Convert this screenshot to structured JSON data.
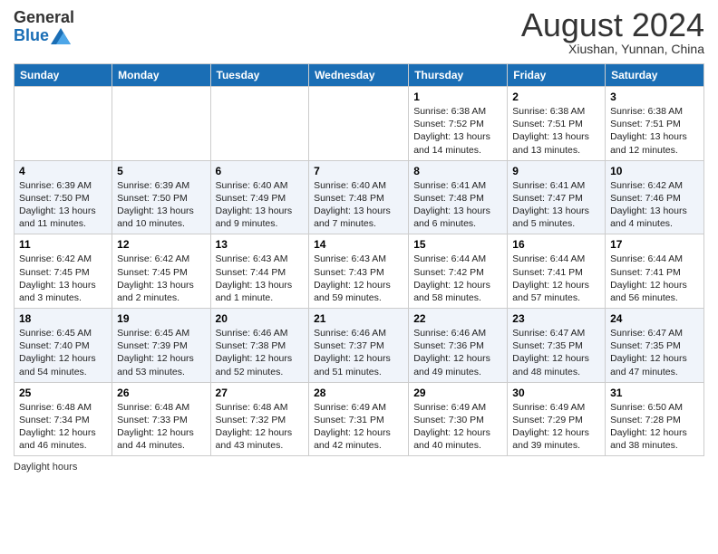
{
  "logo": {
    "general": "General",
    "blue": "Blue"
  },
  "title": "August 2024",
  "subtitle": "Xiushan, Yunnan, China",
  "days_header": [
    "Sunday",
    "Monday",
    "Tuesday",
    "Wednesday",
    "Thursday",
    "Friday",
    "Saturday"
  ],
  "weeks": [
    [
      {
        "day": "",
        "info": ""
      },
      {
        "day": "",
        "info": ""
      },
      {
        "day": "",
        "info": ""
      },
      {
        "day": "",
        "info": ""
      },
      {
        "day": "1",
        "info": "Sunrise: 6:38 AM\nSunset: 7:52 PM\nDaylight: 13 hours and 14 minutes."
      },
      {
        "day": "2",
        "info": "Sunrise: 6:38 AM\nSunset: 7:51 PM\nDaylight: 13 hours and 13 minutes."
      },
      {
        "day": "3",
        "info": "Sunrise: 6:38 AM\nSunset: 7:51 PM\nDaylight: 13 hours and 12 minutes."
      }
    ],
    [
      {
        "day": "4",
        "info": "Sunrise: 6:39 AM\nSunset: 7:50 PM\nDaylight: 13 hours and 11 minutes."
      },
      {
        "day": "5",
        "info": "Sunrise: 6:39 AM\nSunset: 7:50 PM\nDaylight: 13 hours and 10 minutes."
      },
      {
        "day": "6",
        "info": "Sunrise: 6:40 AM\nSunset: 7:49 PM\nDaylight: 13 hours and 9 minutes."
      },
      {
        "day": "7",
        "info": "Sunrise: 6:40 AM\nSunset: 7:48 PM\nDaylight: 13 hours and 7 minutes."
      },
      {
        "day": "8",
        "info": "Sunrise: 6:41 AM\nSunset: 7:48 PM\nDaylight: 13 hours and 6 minutes."
      },
      {
        "day": "9",
        "info": "Sunrise: 6:41 AM\nSunset: 7:47 PM\nDaylight: 13 hours and 5 minutes."
      },
      {
        "day": "10",
        "info": "Sunrise: 6:42 AM\nSunset: 7:46 PM\nDaylight: 13 hours and 4 minutes."
      }
    ],
    [
      {
        "day": "11",
        "info": "Sunrise: 6:42 AM\nSunset: 7:45 PM\nDaylight: 13 hours and 3 minutes."
      },
      {
        "day": "12",
        "info": "Sunrise: 6:42 AM\nSunset: 7:45 PM\nDaylight: 13 hours and 2 minutes."
      },
      {
        "day": "13",
        "info": "Sunrise: 6:43 AM\nSunset: 7:44 PM\nDaylight: 13 hours and 1 minute."
      },
      {
        "day": "14",
        "info": "Sunrise: 6:43 AM\nSunset: 7:43 PM\nDaylight: 12 hours and 59 minutes."
      },
      {
        "day": "15",
        "info": "Sunrise: 6:44 AM\nSunset: 7:42 PM\nDaylight: 12 hours and 58 minutes."
      },
      {
        "day": "16",
        "info": "Sunrise: 6:44 AM\nSunset: 7:41 PM\nDaylight: 12 hours and 57 minutes."
      },
      {
        "day": "17",
        "info": "Sunrise: 6:44 AM\nSunset: 7:41 PM\nDaylight: 12 hours and 56 minutes."
      }
    ],
    [
      {
        "day": "18",
        "info": "Sunrise: 6:45 AM\nSunset: 7:40 PM\nDaylight: 12 hours and 54 minutes."
      },
      {
        "day": "19",
        "info": "Sunrise: 6:45 AM\nSunset: 7:39 PM\nDaylight: 12 hours and 53 minutes."
      },
      {
        "day": "20",
        "info": "Sunrise: 6:46 AM\nSunset: 7:38 PM\nDaylight: 12 hours and 52 minutes."
      },
      {
        "day": "21",
        "info": "Sunrise: 6:46 AM\nSunset: 7:37 PM\nDaylight: 12 hours and 51 minutes."
      },
      {
        "day": "22",
        "info": "Sunrise: 6:46 AM\nSunset: 7:36 PM\nDaylight: 12 hours and 49 minutes."
      },
      {
        "day": "23",
        "info": "Sunrise: 6:47 AM\nSunset: 7:35 PM\nDaylight: 12 hours and 48 minutes."
      },
      {
        "day": "24",
        "info": "Sunrise: 6:47 AM\nSunset: 7:35 PM\nDaylight: 12 hours and 47 minutes."
      }
    ],
    [
      {
        "day": "25",
        "info": "Sunrise: 6:48 AM\nSunset: 7:34 PM\nDaylight: 12 hours and 46 minutes."
      },
      {
        "day": "26",
        "info": "Sunrise: 6:48 AM\nSunset: 7:33 PM\nDaylight: 12 hours and 44 minutes."
      },
      {
        "day": "27",
        "info": "Sunrise: 6:48 AM\nSunset: 7:32 PM\nDaylight: 12 hours and 43 minutes."
      },
      {
        "day": "28",
        "info": "Sunrise: 6:49 AM\nSunset: 7:31 PM\nDaylight: 12 hours and 42 minutes."
      },
      {
        "day": "29",
        "info": "Sunrise: 6:49 AM\nSunset: 7:30 PM\nDaylight: 12 hours and 40 minutes."
      },
      {
        "day": "30",
        "info": "Sunrise: 6:49 AM\nSunset: 7:29 PM\nDaylight: 12 hours and 39 minutes."
      },
      {
        "day": "31",
        "info": "Sunrise: 6:50 AM\nSunset: 7:28 PM\nDaylight: 12 hours and 38 minutes."
      }
    ]
  ],
  "footer": "Daylight hours"
}
